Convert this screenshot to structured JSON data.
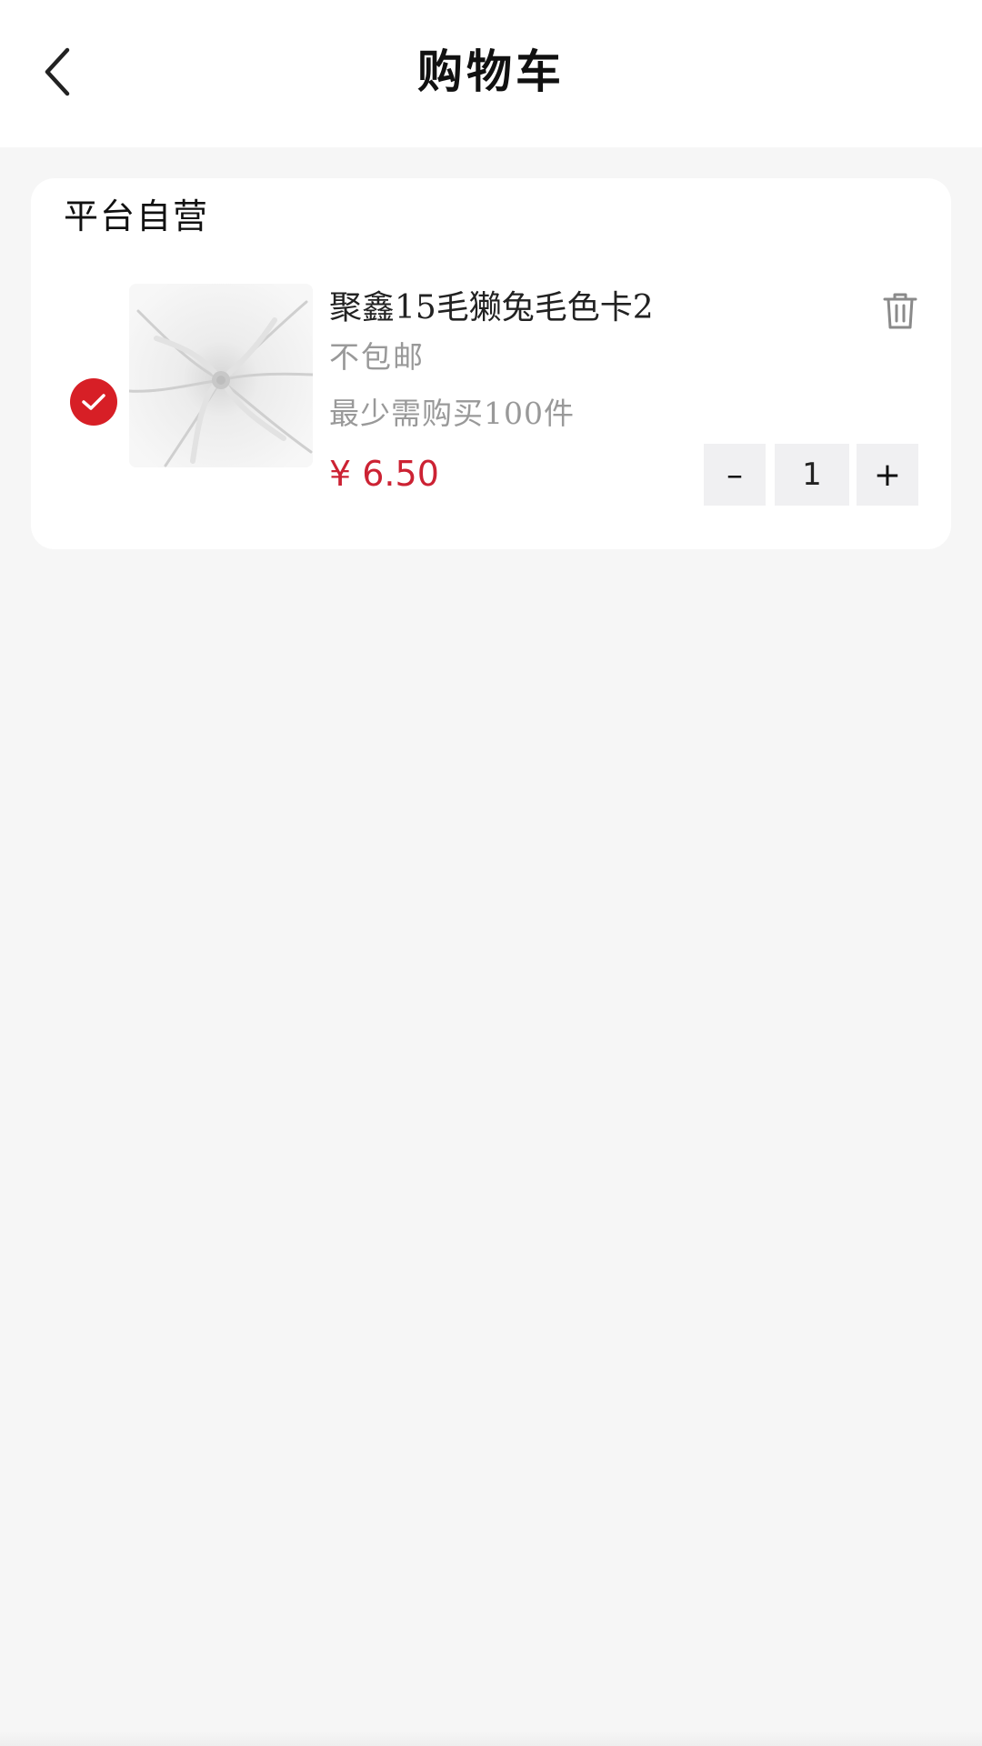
{
  "header": {
    "back_icon": "chevron-left-icon",
    "title": "购物车"
  },
  "cart": {
    "shop_name": "平台自营",
    "items": [
      {
        "selected": true,
        "title": "聚鑫15毛獭兔毛色卡2",
        "shipping": "不包邮",
        "min_order": "最少需购买100件",
        "price": "¥ 6.50",
        "quantity": "1",
        "minus_label": "–",
        "plus_label": "+",
        "delete_icon": "trash-icon",
        "check_icon": "check-circle-icon"
      }
    ]
  },
  "colors": {
    "accent": "#d71f26",
    "price": "#cc2233",
    "background": "#f6f6f6",
    "card": "#ffffff",
    "muted_text": "#999999",
    "stepper_bg": "#f0f0f2"
  }
}
